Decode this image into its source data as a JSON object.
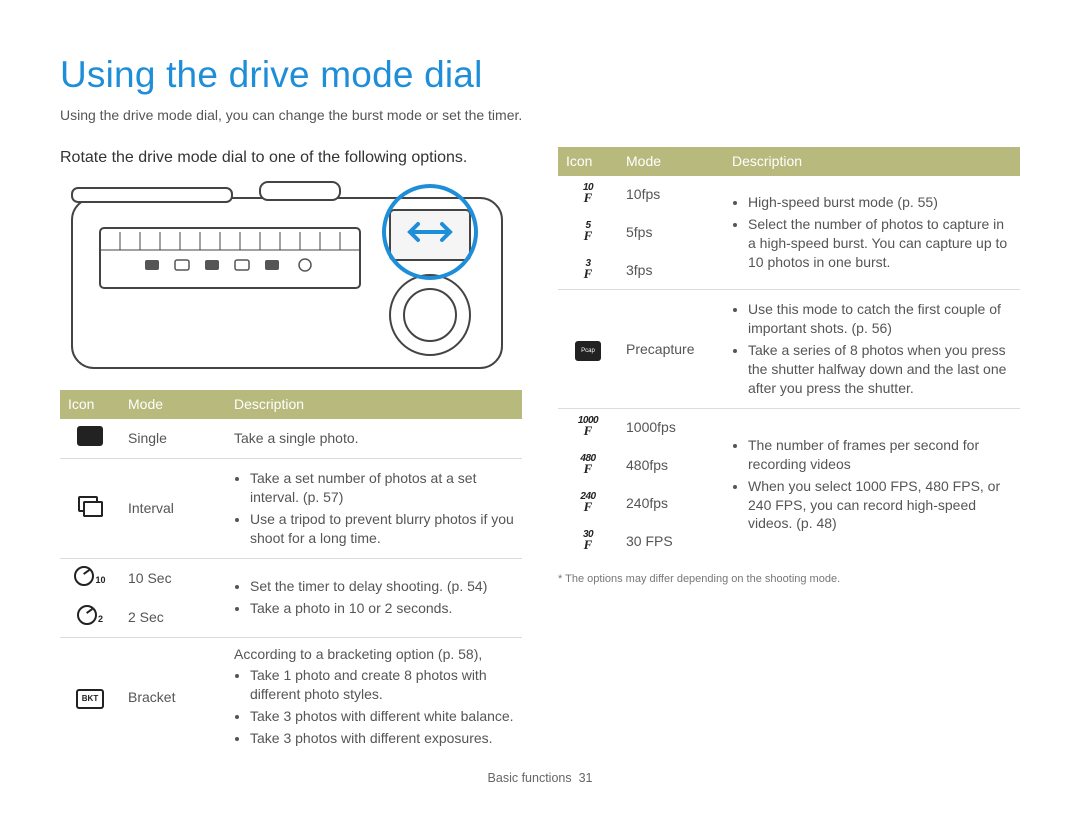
{
  "title": "Using the drive mode dial",
  "subtitle": "Using the drive mode dial, you can change the burst mode or set the timer.",
  "instruction": "Rotate the drive mode dial to one of the following options.",
  "headers": {
    "icon": "Icon",
    "mode": "Mode",
    "description": "Description"
  },
  "left_rows": {
    "single": {
      "mode": "Single",
      "desc_text": "Take a single photo."
    },
    "interval": {
      "mode": "Interval",
      "b1": "Take a set number of photos at a set interval. (p. 57)",
      "b2": "Use a tripod to prevent blurry photos if you shoot for a long time."
    },
    "t10": {
      "mode": "10 Sec",
      "b1": "Set the timer to delay shooting. (p. 54)"
    },
    "t2": {
      "mode": "2 Sec",
      "b2": "Take a photo in 10 or 2 seconds."
    },
    "bracket": {
      "mode": "Bracket",
      "intro": "According to a bracketing option (p. 58),",
      "b1": "Take 1 photo and create 8 photos with different photo styles.",
      "b2": "Take 3 photos with different white balance.",
      "b3": "Take 3 photos with different exposures."
    }
  },
  "right_rows": {
    "f10": {
      "mode": "10fps",
      "icon_top": "10"
    },
    "f5": {
      "mode": "5fps",
      "icon_top": "5"
    },
    "f3": {
      "mode": "3fps",
      "icon_top": "3"
    },
    "hs": {
      "b1": "High-speed burst mode (p. 55)",
      "b2": "Select the number of photos to capture in a high-speed burst. You can capture up to 10 photos in one burst."
    },
    "pre": {
      "mode": "Precapture",
      "b1": "Use this mode to catch the first couple of important shots. (p. 56)",
      "b2": "Take a series of 8 photos when you press the shutter halfway down and the last one after you press the shutter."
    },
    "f1000": {
      "mode": "1000fps",
      "icon_top": "1000"
    },
    "f480": {
      "mode": "480fps",
      "icon_top": "480"
    },
    "f240": {
      "mode": "240fps",
      "icon_top": "240"
    },
    "f30": {
      "mode": "30 FPS",
      "icon_top": "30"
    },
    "fps": {
      "b1": "The number of frames per second for recording videos",
      "b2": "When you select 1000 FPS, 480 FPS, or 240 FPS, you can record high-speed videos. (p. 48)"
    }
  },
  "footnote": "* The options may differ depending on the shooting mode.",
  "footer_section": "Basic functions",
  "footer_page": "31"
}
